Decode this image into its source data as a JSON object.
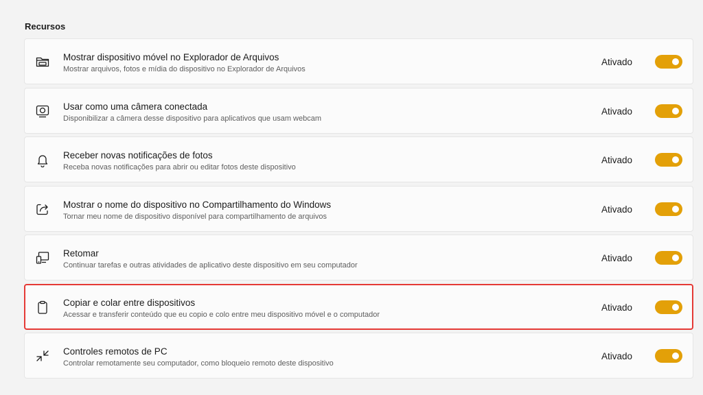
{
  "section": {
    "title": "Recursos"
  },
  "accent_color": "#e3a008",
  "highlight_color": "#e53935",
  "items": [
    {
      "icon": "folder-icon",
      "title": "Mostrar dispositivo móvel no Explorador de Arquivos",
      "description": "Mostrar arquivos, fotos e mídia do dispositivo no Explorador de Arquivos",
      "status": "Ativado",
      "enabled": true
    },
    {
      "icon": "webcam-icon",
      "title": "Usar como uma câmera conectada",
      "description": "Disponibilizar a câmera desse dispositivo para aplicativos que usam webcam",
      "status": "Ativado",
      "enabled": true
    },
    {
      "icon": "bell-icon",
      "title": "Receber novas notificações de fotos",
      "description": "Receba novas notificações para abrir ou editar fotos deste dispositivo",
      "status": "Ativado",
      "enabled": true
    },
    {
      "icon": "share-icon",
      "title": "Mostrar o nome do dispositivo no Compartilhamento do Windows",
      "description": "Tornar meu nome de dispositivo disponível para compartilhamento de arquivos",
      "status": "Ativado",
      "enabled": true
    },
    {
      "icon": "devices-icon",
      "title": "Retomar",
      "description": "Continuar tarefas e outras atividades de aplicativo deste dispositivo em seu computador",
      "status": "Ativado",
      "enabled": true
    },
    {
      "icon": "clipboard-icon",
      "title": "Copiar e colar entre dispositivos",
      "description": "Acessar e transferir conteúdo que eu copio e colo entre meu dispositivo móvel e o computador",
      "status": "Ativado",
      "enabled": true,
      "highlighted": true
    },
    {
      "icon": "remote-control-icon",
      "title": "Controles remotos de PC",
      "description": "Controlar remotamente seu computador, como bloqueio remoto deste dispositivo",
      "status": "Ativado",
      "enabled": true
    }
  ]
}
